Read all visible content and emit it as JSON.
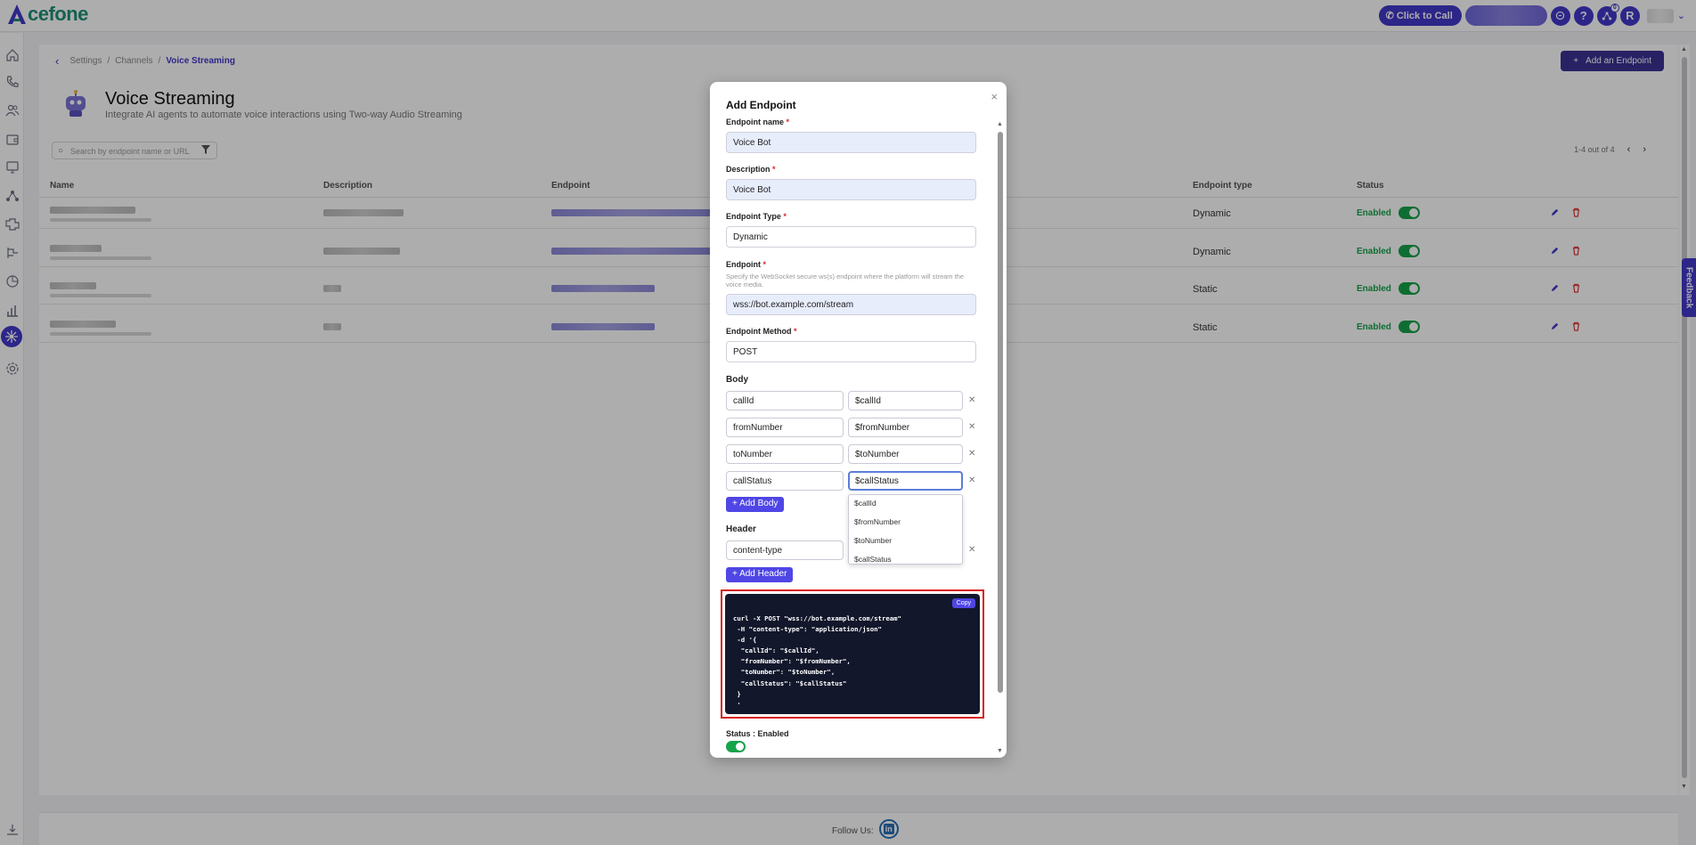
{
  "app": {
    "brand": "cefone",
    "brand_color": "#1e8f76",
    "accent": "#4338ca"
  },
  "topbar": {
    "click_to_call": "Click to Call",
    "help_icon": "?",
    "avatar_initial": "R",
    "notification_count": "0"
  },
  "sidebar": {
    "items": [
      "home-icon",
      "phone-icon",
      "users-icon",
      "wallet-icon",
      "monitor-icon",
      "network-icon",
      "integrations-icon",
      "ivr-icon",
      "reports-pie-icon",
      "analytics-icon",
      "voice-streaming-icon",
      "settings-icon"
    ],
    "active": "voice-streaming-icon",
    "bottom": "download-icon"
  },
  "breadcrumb": {
    "items": [
      "Settings",
      "Channels"
    ],
    "current": "Voice Streaming"
  },
  "header": {
    "add_button": "Add an Endpoint",
    "title": "Voice Streaming",
    "subtitle": "Integrate AI agents to automate voice interactions using Two-way Audio Streaming"
  },
  "search": {
    "placeholder": "Search by endpoint name or URL"
  },
  "pager": {
    "text": "1-4 out of 4"
  },
  "table": {
    "columns": [
      "Name",
      "Description",
      "Endpoint",
      "Endpoint type",
      "Status"
    ],
    "rows": [
      {
        "type": "Dynamic",
        "status": "Enabled"
      },
      {
        "type": "Dynamic",
        "status": "Enabled"
      },
      {
        "type": "Static",
        "status": "Enabled"
      },
      {
        "type": "Static",
        "status": "Enabled"
      }
    ]
  },
  "footer": {
    "follow": "Follow Us:",
    "linkedin": "in"
  },
  "feedback": "Feedback",
  "modal": {
    "title": "Add Endpoint",
    "close": "×",
    "endpoint_name": {
      "label": "Endpoint name",
      "value": "Voice Bot"
    },
    "description": {
      "label": "Description",
      "value": "Voice Bot"
    },
    "endpoint_type": {
      "label": "Endpoint Type",
      "value": "Dynamic"
    },
    "endpoint": {
      "label": "Endpoint",
      "hint": "Specify the WebSocket secure ws(s) endpoint where the platform will stream the voice media.",
      "value": "wss://bot.example.com/stream"
    },
    "endpoint_method": {
      "label": "Endpoint Method",
      "value": "POST"
    },
    "required_mark": "*",
    "body": {
      "label": "Body",
      "rows": [
        {
          "key": "callId",
          "value": "$callId"
        },
        {
          "key": "fromNumber",
          "value": "$fromNumber"
        },
        {
          "key": "toNumber",
          "value": "$toNumber"
        },
        {
          "key": "callStatus",
          "value": "$callStatus"
        }
      ],
      "add_button": "+ Add Body"
    },
    "dropdown": [
      "$callId",
      "$fromNumber",
      "$toNumber",
      "$callStatus"
    ],
    "header": {
      "label": "Header",
      "rows": [
        {
          "key": "content-type",
          "value": ""
        }
      ],
      "add_button": "+ Add Header"
    },
    "copy_button": "Copy",
    "code": "curl -X POST \"wss://bot.example.com/stream\"\n -H \"content-type\": \"application/json\"\n -d '{\n  \"callId\": \"$callId\",\n  \"fromNumber\": \"$fromNumber\",\n  \"toNumber\": \"$toNumber\",\n  \"callStatus\": \"$callStatus\"\n }\n '",
    "status": "Status : Enabled"
  }
}
